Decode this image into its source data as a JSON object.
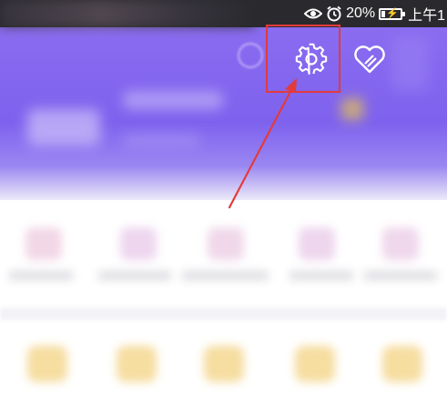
{
  "status_bar": {
    "icons": [
      "eye-icon",
      "alarm-icon",
      "battery-icon"
    ],
    "battery_level": "20%",
    "battery_fraction": 0.2,
    "time_partial": "上午1"
  },
  "header": {
    "background_color": "#7e62ee",
    "icons": [
      "smile-icon",
      "settings-icon",
      "heart-icon"
    ]
  },
  "annotation": {
    "highlight_color": "#e23b3b",
    "arrow_color": "#e23b3b"
  }
}
